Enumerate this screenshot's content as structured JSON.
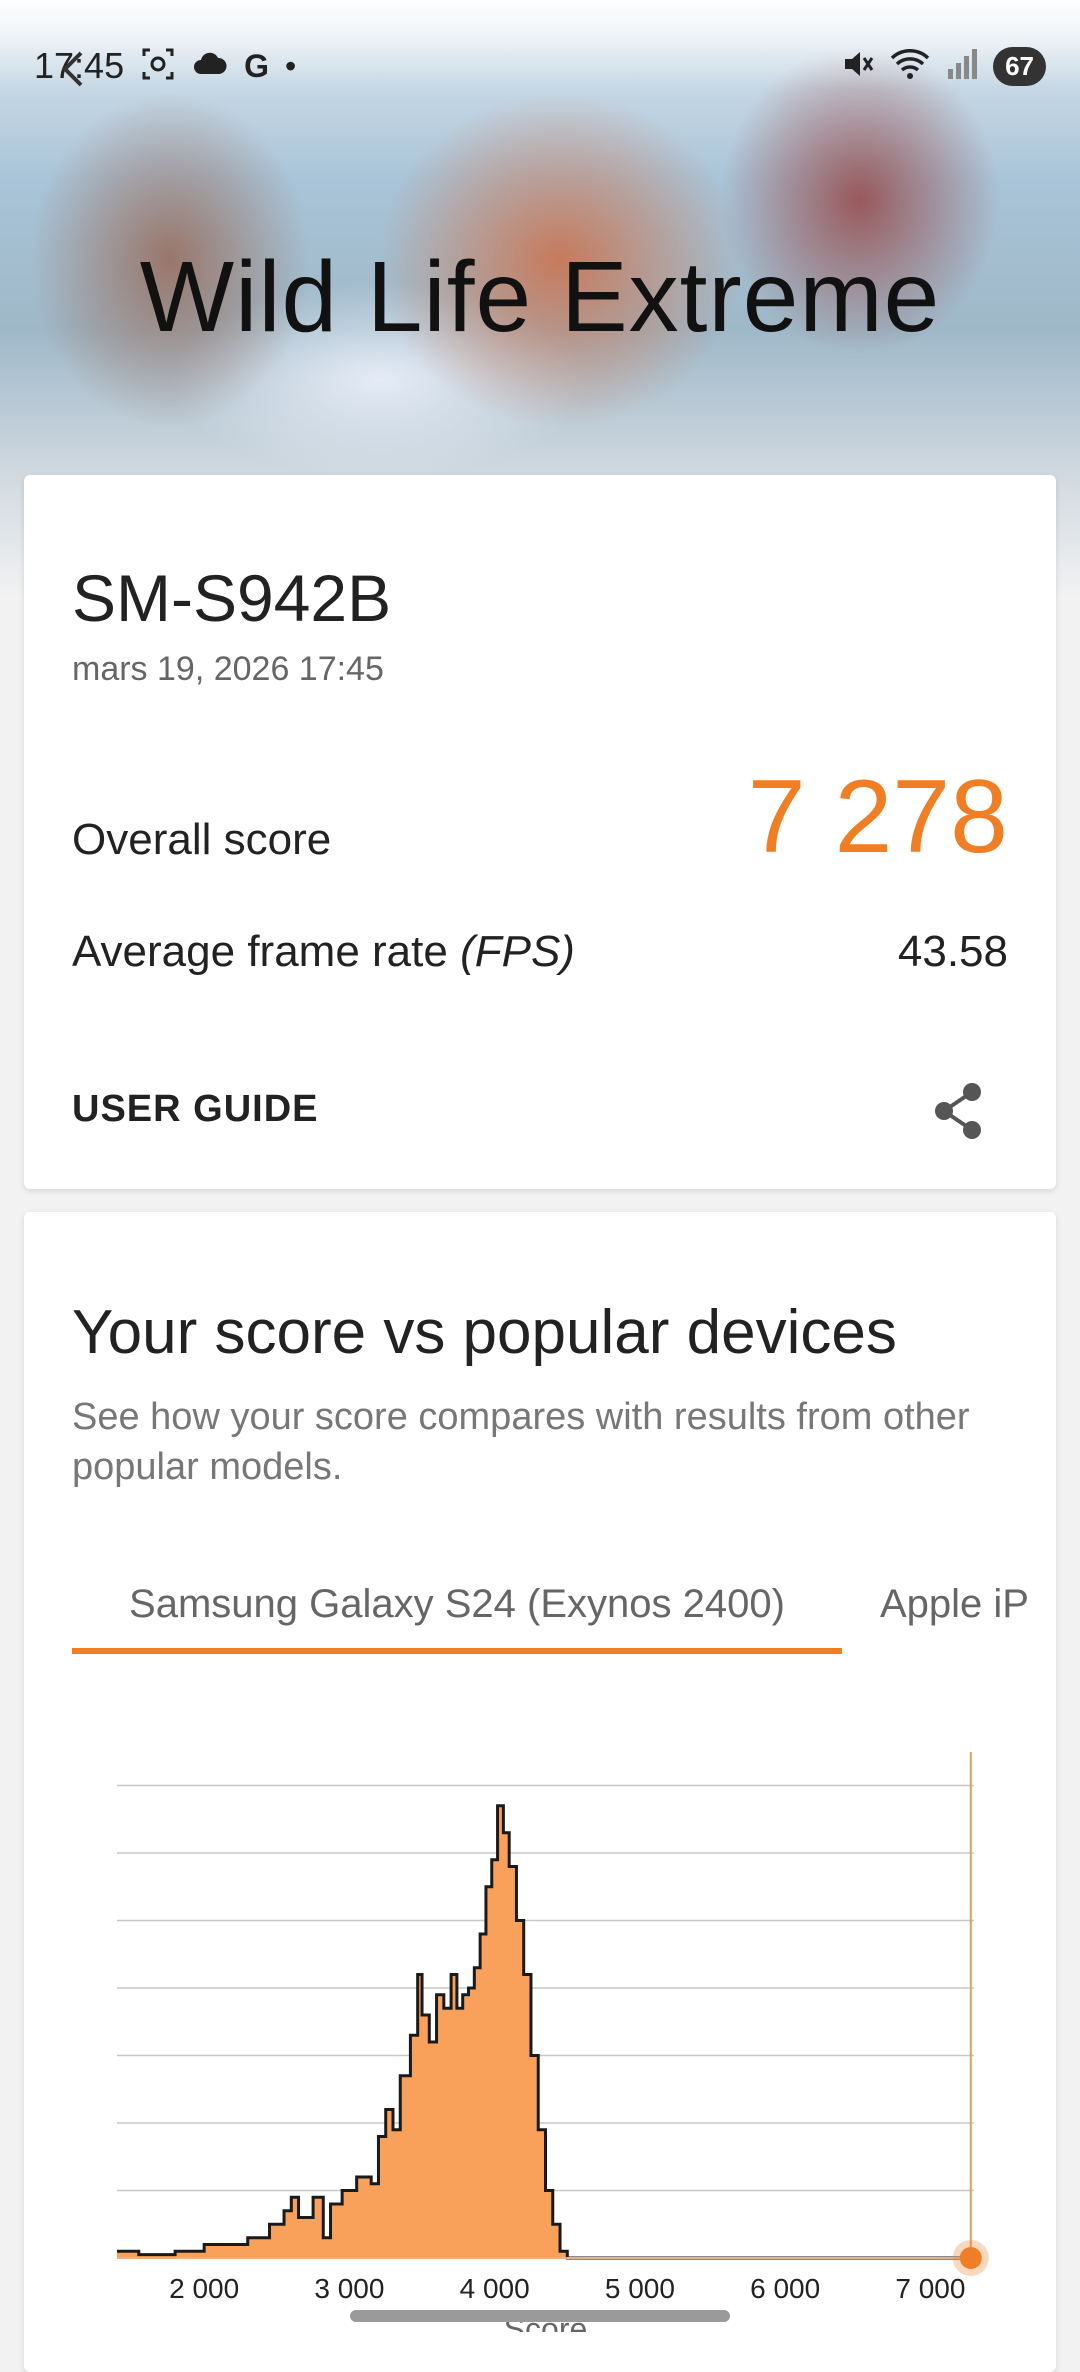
{
  "status_bar": {
    "time": "17:45",
    "battery": "67",
    "left_icons": [
      "screenshot-icon",
      "cloud-icon",
      "google-icon",
      "dot-icon"
    ],
    "right_icons": [
      "mute-icon",
      "wifi-icon",
      "signal-icon"
    ]
  },
  "hero": {
    "title": "Wild Life Extreme"
  },
  "result": {
    "device": "SM-S942B",
    "date": "mars 19, 2026 17:45",
    "overall_label": "Overall score",
    "overall_value": "7 278",
    "fps_label": "Average frame rate",
    "fps_unit": "(FPS)",
    "fps_value": "43.58",
    "user_guide": "USER GUIDE",
    "accent_color": "#f07e25"
  },
  "compare": {
    "title": "Your score vs popular devices",
    "description": "See how your score compares with results from other popular models.",
    "tabs": [
      {
        "label": "Samsung Galaxy S24 (Exynos 2400)",
        "active": true
      },
      {
        "label": "Apple iP",
        "active": false
      }
    ]
  },
  "chart_data": {
    "type": "area",
    "xlabel": "Score",
    "ylabel": "",
    "xlim": [
      1400,
      7300
    ],
    "ylim": [
      0,
      7.2
    ],
    "xticks": [
      "2 000",
      "3 000",
      "4 000",
      "5 000",
      "6 000",
      "7 000"
    ],
    "xtick_values": [
      2000,
      3000,
      4000,
      5000,
      6000,
      7000
    ],
    "grid": true,
    "series": [
      {
        "x": [
          1400,
          1550,
          1800,
          2000,
          2150,
          2300,
          2450,
          2550,
          2600,
          2650,
          2750,
          2820,
          2870,
          2950,
          3050,
          3150,
          3200,
          3250,
          3300,
          3350,
          3420,
          3470,
          3500,
          3550,
          3600,
          3650,
          3700,
          3740,
          3780,
          3820,
          3860,
          3900,
          3940,
          3980,
          4020,
          4060,
          4100,
          4150,
          4200,
          4250,
          4300,
          4350,
          4400,
          4450,
          4500,
          4600,
          5000,
          6000,
          7000,
          7300
        ],
        "y": [
          0.1,
          0.05,
          0.1,
          0.2,
          0.2,
          0.3,
          0.5,
          0.7,
          0.9,
          0.6,
          0.9,
          0.3,
          0.8,
          1.0,
          1.2,
          1.1,
          1.8,
          2.2,
          1.9,
          2.7,
          3.3,
          4.2,
          3.6,
          3.2,
          3.9,
          3.7,
          4.2,
          3.7,
          3.9,
          4.0,
          4.3,
          4.8,
          5.5,
          5.9,
          6.7,
          6.3,
          5.8,
          5.0,
          4.2,
          3.0,
          1.9,
          1.0,
          0.5,
          0.1,
          0.0,
          0.0,
          0.0,
          0.0,
          0.0,
          0.0
        ]
      }
    ],
    "marker": {
      "x": 7278,
      "color": "#f07e25"
    },
    "fill_color": "#f9a15a",
    "line_color": "#1a1a1a",
    "marker_line_color": "#e0a060"
  }
}
